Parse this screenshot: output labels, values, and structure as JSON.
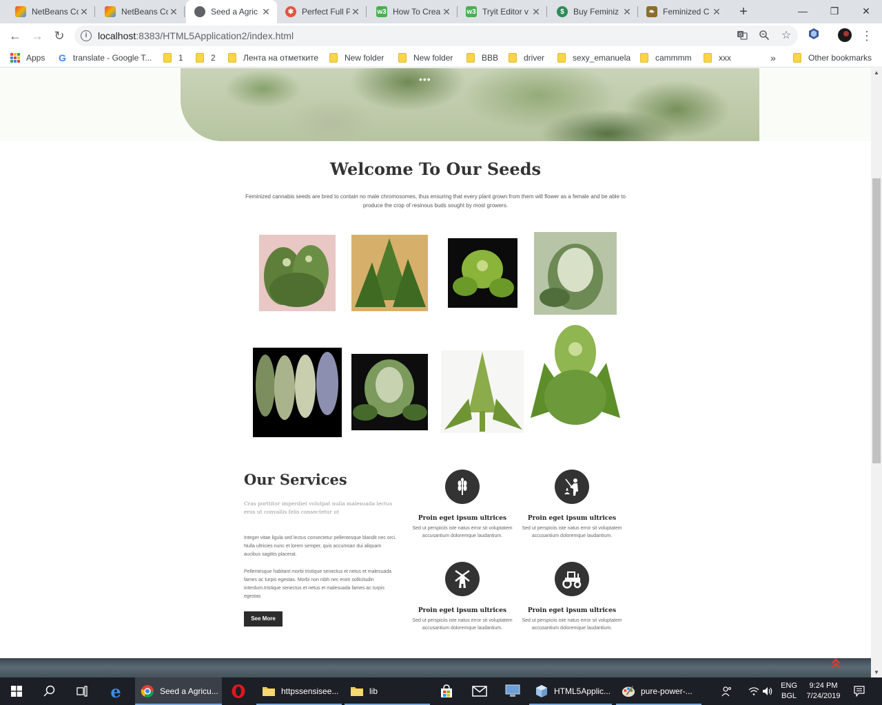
{
  "tabs": [
    {
      "title": "NetBeans Co",
      "fav_color": "#e04a3f",
      "active": false
    },
    {
      "title": "NetBeans Co",
      "fav_color": "#e04a3f",
      "active": false
    },
    {
      "title": "Seed a Agric",
      "fav_color": "#5f6368",
      "active": true
    },
    {
      "title": "Perfect Full P",
      "fav_color": "#e5533d",
      "active": false
    },
    {
      "title": "How To Crea",
      "fav_color": "#4caf50",
      "active": false
    },
    {
      "title": "Tryit Editor v",
      "fav_color": "#4caf50",
      "active": false
    },
    {
      "title": "Buy Feminiz",
      "fav_color": "#2e8b57",
      "active": false
    },
    {
      "title": "Feminized C",
      "fav_color": "#8b6d2e",
      "active": false
    }
  ],
  "tab_close": "✕",
  "new_tab": "+",
  "window": {
    "minimize": "—",
    "maximize": "❐",
    "close": "✕"
  },
  "nav": {
    "back": "←",
    "forward": "→",
    "reload": "↻"
  },
  "address": {
    "host": "localhost",
    "rest": ":8383/HTML5Application2/index.html"
  },
  "bookmarks": [
    {
      "label": "Apps",
      "type": "apps"
    },
    {
      "label": "translate - Google T...",
      "type": "google"
    },
    {
      "label": "1",
      "type": "folder"
    },
    {
      "label": "2",
      "type": "folder"
    },
    {
      "label": "Лента на отметките",
      "type": "folder"
    },
    {
      "label": "New folder",
      "type": "folder"
    },
    {
      "label": "New folder",
      "type": "folder"
    },
    {
      "label": "BBB",
      "type": "folder"
    },
    {
      "label": "driver",
      "type": "folder"
    },
    {
      "label": "sexy_emanuela",
      "type": "folder"
    },
    {
      "label": "cammmm",
      "type": "folder"
    },
    {
      "label": "xxx",
      "type": "folder"
    }
  ],
  "bookmarks_overflow": "»",
  "other_bookmarks": "Other bookmarks",
  "page": {
    "hero_dots": "•••",
    "welcome_title": "Welcome To Our Seeds",
    "welcome_text": "Feminized cannabis seeds are bred to contain no male chromosomes, thus ensuring that every plant grown from them will flower as a female and be able to produce the crop of resinous buds sought by most growers.",
    "services_title": "Our Services",
    "services_lead": "Cras porttitor imperdiet volutpat nulla malesuada lectus eros ut convallis felis consectetur ut",
    "services_p1": "Integer vitae ligula sed lectus consectetur pellentesque blandit nec orci. Nulla ultricies nunc et lorem semper, quis accumsan dui aliquam aucibus sagittis placerat.",
    "services_p2": "Pellentesque habitant morbi tristique senectus et netus et malesuada fames ac turpis egestas. Morbi non nibh nec enim sollicitudin interdum.tristique senectus et netus et malesuada fames ac turpis egestas",
    "see_more": "See More",
    "services": [
      {
        "name": "Proin eget ipsum ultrices",
        "desc": "Sed ut perspiciis iste natus error sit voluptatem accusantium doloremque laudantium.",
        "icon": "wheat-icon"
      },
      {
        "name": "Proin eget ipsum ultrices",
        "desc": "Sed ut perspiciis iste natus error sit voluptatem accusantium doloremque laudantium.",
        "icon": "farmer-icon"
      },
      {
        "name": "Proin eget ipsum ultrices",
        "desc": "Sed ut perspiciis iste natus error sit voluptatem accusantium doloremque laudantium.",
        "icon": "windmill-icon"
      },
      {
        "name": "Proin eget ipsum ultrices",
        "desc": "Sed ut perspiciis iste natus error sit voluptatem accusantium doloremque laudantium.",
        "icon": "tractor-icon"
      }
    ],
    "to_top": "⌃⌃",
    "gallery": [
      {
        "bg": "#e8c7c4",
        "plant": "#5d7f3a"
      },
      {
        "bg": "#d6b06a",
        "plant": "#4e7a2c"
      },
      {
        "bg": "#0b0b0b",
        "plant": "#8ab43a"
      },
      {
        "bg": "#b7c4a6",
        "plant": "#6d8a55"
      },
      {
        "bg": "#000000",
        "plant": "#9aa88a"
      },
      {
        "bg": "#0d0d0d",
        "plant": "#7b9a5c"
      },
      {
        "bg": "#f6f6f4",
        "plant": "#8cab4a"
      },
      {
        "bg": "#ffffff",
        "plant": "#6c9a3a"
      }
    ]
  },
  "taskbar": {
    "apps": [
      {
        "label": "Seed a Agricu...",
        "icon": "chrome-icon"
      },
      {
        "label": "httpssensisee...",
        "icon": "folder-icon"
      },
      {
        "label": "lib",
        "icon": "folder-icon"
      },
      {
        "label": "HTML5Applic...",
        "icon": "netbeans-icon"
      },
      {
        "label": "pure-power-...",
        "icon": "paint-icon"
      }
    ],
    "lang": "ENG",
    "layout": "BGL",
    "time": "9:24 PM",
    "date": "7/24/2019"
  }
}
